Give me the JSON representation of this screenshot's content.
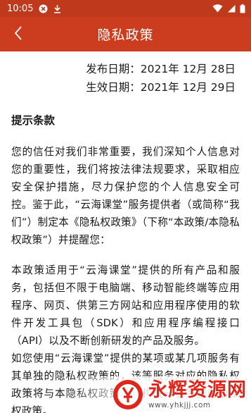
{
  "status_bar": {
    "time": "10:05",
    "icons": [
      "cancel-circle-icon",
      "download-icon",
      "wifi-icon",
      "signal-icon",
      "battery-icon"
    ]
  },
  "app_bar": {
    "title": "隐私政策",
    "back_icon": "chevron-left-icon",
    "background": "#cc3d1f"
  },
  "content": {
    "publish_date": "发布日期：2021年 12月 28日",
    "effective_date": "生效日期：2021年 12月 29日",
    "section_title": "提示条款",
    "paragraphs": [
      "您的信任对我们非常重要，我们深知个人信息对您的重要性，我们将按法律法规要求，采取相应安全保护措施，尽力保护您的个人信息安全可控。鉴于此，“云海课堂”服务提供者（或简称“我们”）制定本《隐私权政策》（下称“本政策/本隐私权政策”）并提醒您：",
      "本政策适用于“云海课堂”提供的所有产品和服务，包括但不限于电脑端、移动智能终端等应用程序、网页、供第三方网站和应用程序使用的软件开发工具包（SDK）和应用程序编程接口（API）以及不断创新研发的产品及服务。",
      "如您使用“云海课堂”提供的某项或某几项服务有其单独的隐私权政策的，该等服务对应的隐私权政策将与本隐私权政策一起构成一套完整的隐私权政策。"
    ]
  },
  "watermark": {
    "title": "永辉资源网",
    "url": "www.yhkjjj.com"
  }
}
